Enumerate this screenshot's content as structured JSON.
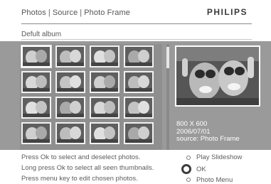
{
  "header": {
    "breadcrumb": [
      "Photos",
      "Source",
      "Photo Frame"
    ],
    "separator": "|",
    "brand": "PHILIPS"
  },
  "album": {
    "name": "Defult album"
  },
  "thumbnails": [
    {
      "icon": "photo-thumbnail",
      "selected": true
    },
    {
      "icon": "photo-thumbnail",
      "selected": false
    },
    {
      "icon": "photo-thumbnail",
      "selected": false
    },
    {
      "icon": "photo-thumbnail",
      "selected": false
    },
    {
      "icon": "photo-thumbnail",
      "selected": false
    },
    {
      "icon": "photo-thumbnail",
      "selected": false
    },
    {
      "icon": "photo-thumbnail",
      "selected": false
    },
    {
      "icon": "photo-thumbnail",
      "selected": false
    },
    {
      "icon": "photo-thumbnail",
      "selected": false
    },
    {
      "icon": "photo-thumbnail",
      "selected": false
    },
    {
      "icon": "photo-thumbnail",
      "selected": false
    },
    {
      "icon": "photo-thumbnail",
      "selected": false
    },
    {
      "icon": "photo-thumbnail",
      "selected": false
    },
    {
      "icon": "photo-thumbnail",
      "selected": false
    },
    {
      "icon": "photo-thumbnail",
      "selected": false
    },
    {
      "icon": "photo-thumbnail",
      "selected": false
    }
  ],
  "preview": {
    "resolution": "800 X 600",
    "date": "2006/07/01",
    "source": "source: Photo Frame"
  },
  "footer": {
    "hints": [
      "Press Ok to select and deselect photos.",
      "Long press Ok to select all seen thumbnails.",
      "Press menu key to edit chosen photos."
    ],
    "options": [
      {
        "label": "Play Slideshow",
        "icon": "radio-icon"
      },
      {
        "label": "OK",
        "icon": "ok-button-icon"
      },
      {
        "label": "Photo Menu",
        "icon": "radio-icon"
      }
    ]
  },
  "colors": {
    "panel": "#9a9a9a",
    "text": "#5c5c5c",
    "brand": "#3b3b3b"
  }
}
